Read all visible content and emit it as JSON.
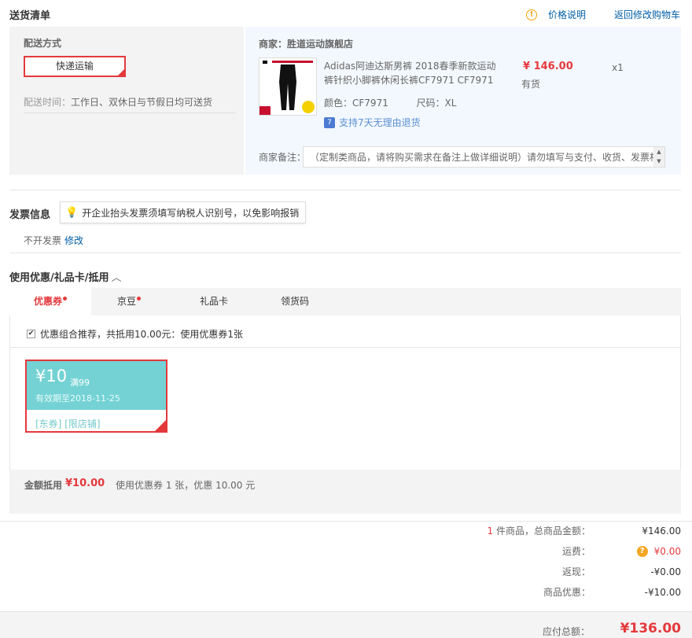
{
  "header": {
    "title": "送货清单",
    "price_note": "价格说明",
    "back_cart": "返回修改购物车"
  },
  "shipping": {
    "label": "配送方式",
    "method": "快递运输",
    "time_label": "配送时间：",
    "time_value": "工作日、双休日与节假日均可送货"
  },
  "goods": {
    "shop_label": "商家：",
    "shop_name": "胜道运动旗舰店",
    "title": "Adidas阿迪达斯男裤 2018春季新款运动裤针织小脚裤休闲长裤CF7971 CF7971",
    "price": "¥ 146.00",
    "stock": "有货",
    "qty": "x1",
    "color_label": "颜色：",
    "color_value": "CF7971",
    "size_label": "尺码：",
    "size_value": "XL",
    "return_policy": "支持7天无理由退货",
    "remark_label": "商家备注：",
    "remark_placeholder": "（定制类商品，请将购买需求在备注上做详细说明）请勿填写与支付、收货、发票相关内容"
  },
  "invoice": {
    "title": "发票信息",
    "tip": "开企业抬头发票须填写纳税人识别号，以免影响报销",
    "status": "不开发票",
    "edit": "修改"
  },
  "coupons": {
    "title": "使用优惠/礼品卡/抵用",
    "tabs": [
      {
        "label": "优惠券",
        "dot": true
      },
      {
        "label": "京豆",
        "dot": true
      },
      {
        "label": "礼品卡",
        "dot": false
      },
      {
        "label": "领货码",
        "dot": false
      }
    ],
    "combo_text": "优惠组合推荐，共抵用10.00元：使用优惠券1张",
    "card": {
      "amount": "¥10",
      "condition": "满99",
      "expiry": "有效期至2018-11-25",
      "tags": "[东券] [限店铺]"
    },
    "deduct_label": "金额抵用",
    "deduct_amount": "¥10.00",
    "deduct_desc": "使用优惠券 1 张，优惠 10.00 元"
  },
  "summary": {
    "count": "1",
    "count_suffix": " 件商品，总商品金额：",
    "goods_total": "¥146.00",
    "shipping_label": "运费：",
    "shipping_value": "¥0.00",
    "cashback_label": "返现：",
    "cashback_value": "-¥0.00",
    "discount_label": "商品优惠：",
    "discount_value": "-¥10.00",
    "payable_label": "应付总额：",
    "payable_value": "¥136.00"
  },
  "colors": {
    "accent": "#e4393c",
    "coupon": "#74d2d4",
    "link": "#005ea7"
  }
}
